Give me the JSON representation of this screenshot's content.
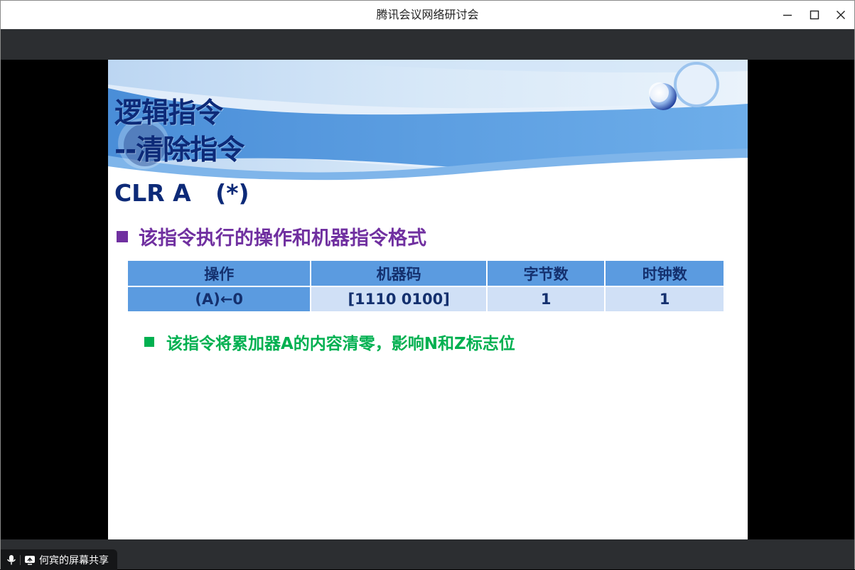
{
  "window": {
    "title": "腾讯会议网络研讨会",
    "minimize_icon": "minimize-icon",
    "maximize_icon": "maximize-icon",
    "close_icon": "close-icon"
  },
  "share_indicator": {
    "mic_icon": "microphone-icon",
    "share_icon": "screen-share-icon",
    "label": "何宾的屏幕共享"
  },
  "slide": {
    "heading_line1": "逻辑指令",
    "heading_line2": "--清除指令",
    "instruction": "CLR A   (*)",
    "bullet1": "该指令执行的操作和机器指令格式",
    "table": {
      "headers": [
        "操作",
        "机器码",
        "字节数",
        "时钟数"
      ],
      "rows": [
        [
          "(A)←0",
          "[1110 0100]",
          "1",
          "1"
        ]
      ]
    },
    "bullet2": "该指令将累加器A的内容清零，影响N和Z标志位"
  },
  "colors": {
    "heading": "#0d2a78",
    "bullet1": "#7030a0",
    "bullet2": "#00b050",
    "table_header": "#5b9be0",
    "table_cell": "#d0e0f6"
  }
}
